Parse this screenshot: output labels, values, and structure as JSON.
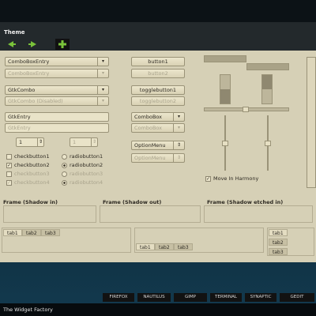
{
  "window": {
    "title": "Theme"
  },
  "toolbar": {
    "back_icon": "arrow-left-icon",
    "forward_icon": "arrow-right-icon",
    "add_icon": "plus-icon"
  },
  "left_col": {
    "combo_entry_1": "ComboBoxEntry",
    "combo_entry_2": "ComboBoxEntry",
    "gtkcombo": "GtkCombo",
    "gtkcombo_disabled": "GtkCombo (Disabled)",
    "entry_1": "GtkEntry",
    "entry_2": "GtkEntry",
    "spin_1": "1",
    "spin_2": "1",
    "checks": [
      "checkbutton1",
      "checkbutton2",
      "checkbutton3",
      "checkbutton4"
    ],
    "radios": [
      "radiobutton1",
      "radiobutton2",
      "radiobutton3",
      "radiobutton4"
    ]
  },
  "middle_col": {
    "button1": "button1",
    "button2": "button2",
    "toggle1": "togglebutton1",
    "toggle2": "togglebutton2",
    "combobox1": "ComboBox",
    "combobox2": "ComboBox",
    "optionmenu1": "OptionMenu",
    "optionmenu2": "OptionMenu"
  },
  "right_col": {
    "move_in_harmony": "Move In Harmony"
  },
  "frames": {
    "in": "Frame (Shadow in)",
    "out": "Frame (Shadow out)",
    "etched": "Frame (Shadow etched in)"
  },
  "tabs_left": [
    "tab1",
    "tab2",
    "tab3"
  ],
  "tabs_center": [
    "tab1",
    "tab2",
    "tab3"
  ],
  "tabs_right": [
    "tab1",
    "tab2",
    "tab3"
  ],
  "taskbar": [
    "FIREFOX",
    "NAUTILUS",
    "GIMP",
    "TERMINAL",
    "SYNAPTIC",
    "GEDIT"
  ],
  "statusbar": {
    "label": "The Widget Factory"
  }
}
